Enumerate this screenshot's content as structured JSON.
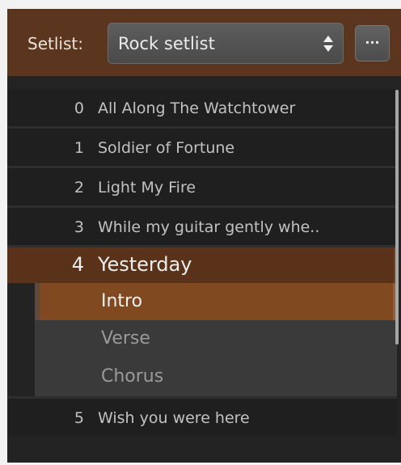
{
  "header": {
    "label": "Setlist:",
    "selected_setlist": "Rock setlist",
    "more_button_label": "···"
  },
  "songs": [
    {
      "num": "0",
      "title": "All Along The Watchtower"
    },
    {
      "num": "1",
      "title": "Soldier of Fortune"
    },
    {
      "num": "2",
      "title": "Light My Fire"
    },
    {
      "num": "3",
      "title": "While my guitar gently whe.."
    },
    {
      "num": "4",
      "title": "Yesterday"
    },
    {
      "num": "5",
      "title": "Wish you were here"
    }
  ],
  "parts": [
    {
      "label": "Intro"
    },
    {
      "label": "Verse"
    },
    {
      "label": "Chorus"
    }
  ],
  "colors": {
    "header_bg": "#5b351e",
    "selected_song_bg": "#5a3219",
    "active_part_bg": "#81491f"
  }
}
